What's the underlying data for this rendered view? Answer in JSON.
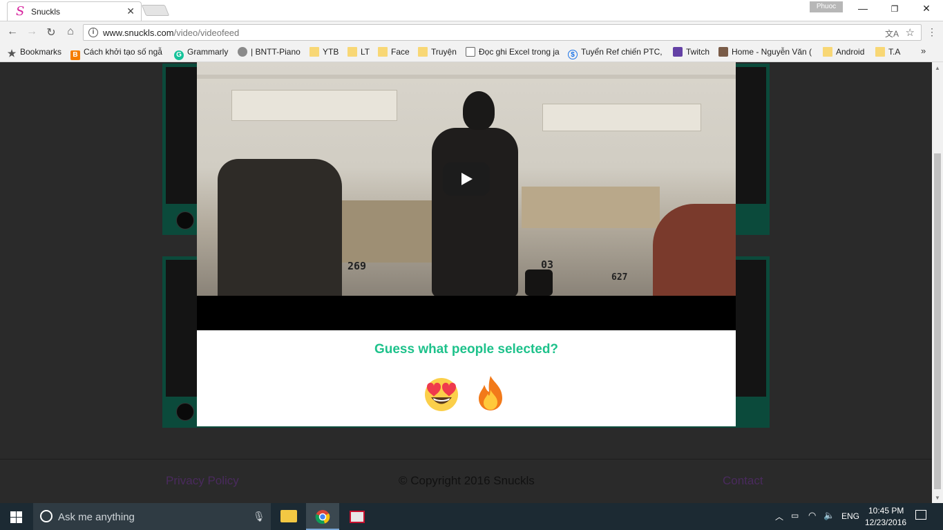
{
  "browser": {
    "tab_title": "Snuckls",
    "tab_favicon": "S",
    "profile_name": "Phuoc",
    "url_host": "www.snuckls.com",
    "url_path": "/video/videofeed",
    "bookmarks": [
      {
        "label": "Bookmarks",
        "icon": "star-icon"
      },
      {
        "label": "Cách khởi tạo số ngẫ",
        "icon": "blogger-icon"
      },
      {
        "label": "Grammarly",
        "icon": "grammarly-icon"
      },
      {
        "label": "| BNTT-Piano",
        "icon": "cat-icon"
      },
      {
        "label": "YTB",
        "icon": "folder-icon"
      },
      {
        "label": "LT",
        "icon": "folder-icon"
      },
      {
        "label": "Face",
        "icon": "folder-icon"
      },
      {
        "label": "Truyện",
        "icon": "folder-icon"
      },
      {
        "label": "Đọc ghi Excel trong ja",
        "icon": "page-icon"
      },
      {
        "label": "Tuyển Ref chiến PTC,",
        "icon": "dollar-icon"
      },
      {
        "label": "Twitch",
        "icon": "twitch-icon"
      },
      {
        "label": "Home - Nguyễn Văn (",
        "icon": "avatar-icon"
      },
      {
        "label": "Android",
        "icon": "folder-icon"
      },
      {
        "label": "T.A",
        "icon": "folder-icon"
      }
    ],
    "more_label": "»"
  },
  "modal": {
    "question": "Guess what people selected?",
    "price_tags": [
      "269",
      "03",
      "627"
    ],
    "emojis": [
      "heart-eyes-emoji",
      "fire-emoji"
    ]
  },
  "footer": {
    "privacy": "Privacy Policy",
    "copyright": "© Copyright 2016 Snuckls",
    "contact": "Contact"
  },
  "taskbar": {
    "search_placeholder": "Ask me anything",
    "language": "ENG",
    "time": "10:45 PM",
    "date": "12/23/2016"
  },
  "colors": {
    "quiz_title": "#1ec28b",
    "card_border": "#0b4a3b",
    "page_bg": "#2a2a2a"
  }
}
